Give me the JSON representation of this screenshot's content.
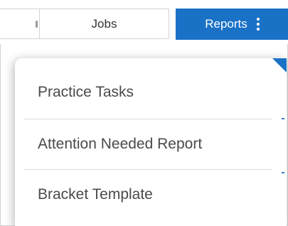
{
  "navbar": {
    "tabs": [
      {
        "label": "Jobs"
      },
      {
        "label": "Reports"
      }
    ]
  },
  "reports_menu": {
    "items": [
      {
        "label": "Practice Tasks"
      },
      {
        "label": "Attention Needed Report"
      },
      {
        "label": "Bracket Template"
      }
    ]
  },
  "colors": {
    "accent": "#1a72c7",
    "menu_text": "#4a4a4a",
    "divider": "#dcdcdc"
  },
  "icons": {
    "reports_more": "kebab-icon"
  }
}
